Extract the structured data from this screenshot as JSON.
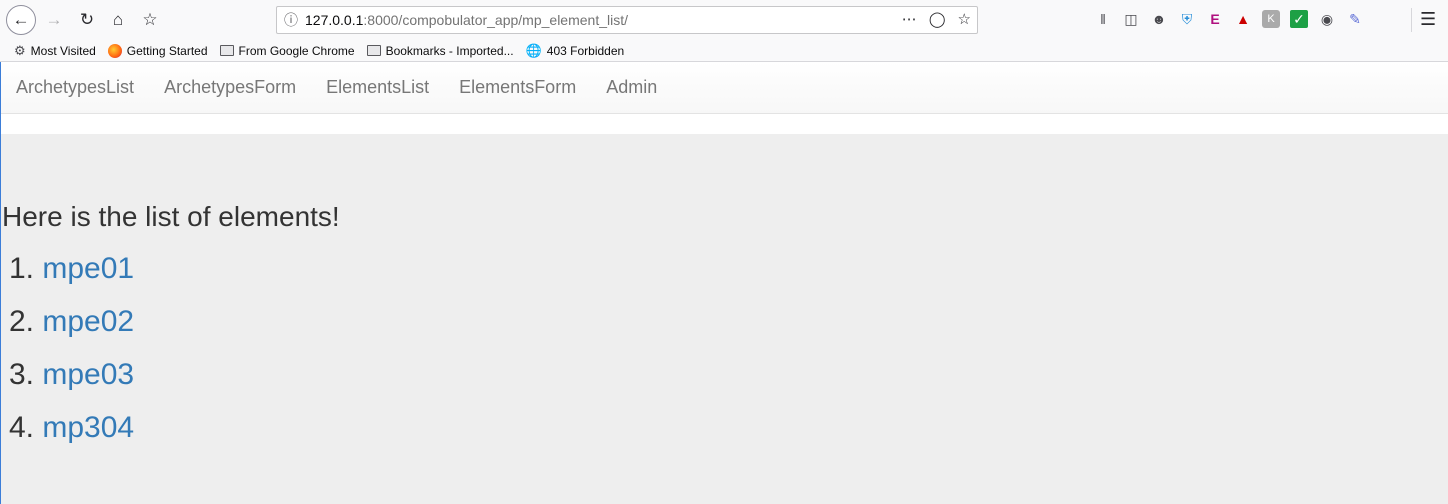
{
  "browser": {
    "url_host": "127.0.0.1",
    "url_rest": ":8000/compobulator_app/mp_element_list/",
    "icons": {
      "back": "back-arrow-icon",
      "forward": "forward-arrow-icon",
      "reload": "reload-icon",
      "home": "home-icon",
      "bookmark_star": "bookmark-star-icon",
      "info": "info-icon",
      "more": "more-actions-icon",
      "pocket": "pocket-icon",
      "star": "star-icon",
      "menu": "hamburger-menu-icon"
    },
    "bookmarks": [
      {
        "label": "Most Visited",
        "icon": "gear-icon"
      },
      {
        "label": "Getting Started",
        "icon": "firefox-icon"
      },
      {
        "label": "From Google Chrome",
        "icon": "folder-icon"
      },
      {
        "label": "Bookmarks - Imported...",
        "icon": "folder-icon"
      },
      {
        "label": "403 Forbidden",
        "icon": "globe-icon"
      }
    ]
  },
  "nav": {
    "items": [
      {
        "label": "ArchetypesList"
      },
      {
        "label": "ArchetypesForm"
      },
      {
        "label": "ElementsList"
      },
      {
        "label": "ElementsForm"
      },
      {
        "label": "Admin"
      }
    ]
  },
  "main": {
    "heading": "Here is the list of elements!",
    "elements": [
      {
        "index": "1.",
        "label": "mpe01"
      },
      {
        "index": "2.",
        "label": "mpe02"
      },
      {
        "index": "3.",
        "label": "mpe03"
      },
      {
        "index": "4.",
        "label": "mp304"
      }
    ]
  },
  "colors": {
    "link": "#337ab7",
    "text": "#333333",
    "nav_text": "#777777",
    "page_bg": "#eeeeee"
  }
}
